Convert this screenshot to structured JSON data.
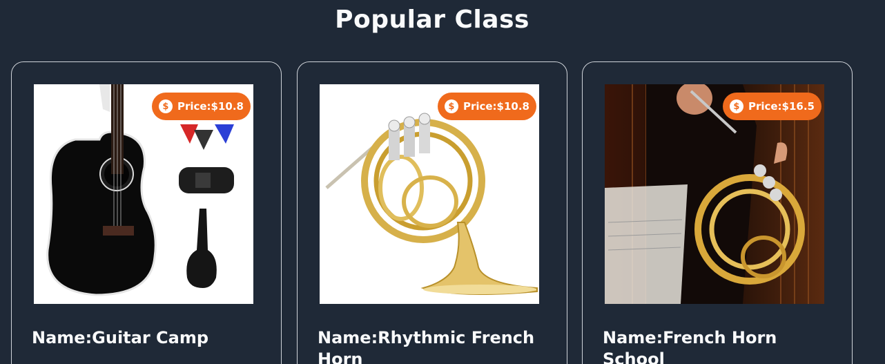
{
  "page": {
    "heading": "Popular Class"
  },
  "classes": [
    {
      "price": "Price:$10.8",
      "name": "Name:Guitar Camp",
      "image_icon": "acoustic-guitar-icon"
    },
    {
      "price": "Price:$10.8",
      "name": "Name:Rhythmic French Horn",
      "image_icon": "french-horn-icon"
    },
    {
      "price": "Price:$16.5",
      "name": "Name:French Horn School",
      "image_icon": "french-horn-player-icon"
    }
  ],
  "colors": {
    "background": "#1f2937",
    "badge": "#f06a1c",
    "card_border": "#d1d5db"
  }
}
